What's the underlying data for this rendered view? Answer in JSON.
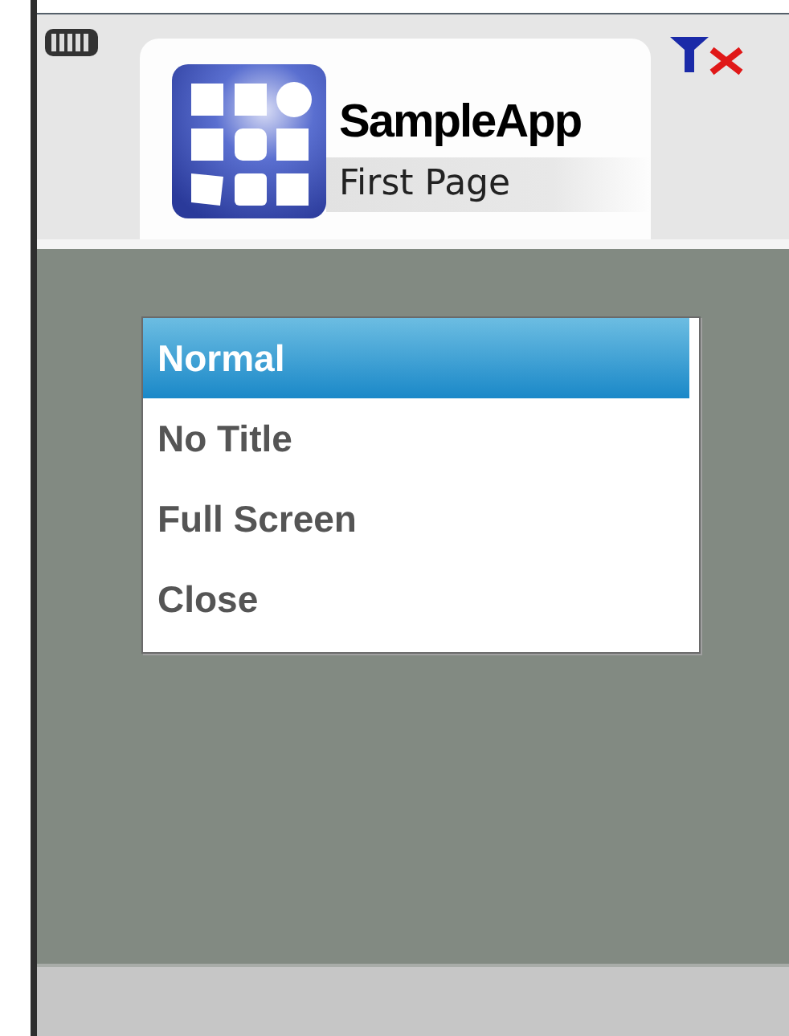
{
  "header": {
    "title": "SampleApp",
    "subtitle": "First Page"
  },
  "menu": [
    {
      "label": "Normal",
      "selected": true
    },
    {
      "label": "No Title",
      "selected": false
    },
    {
      "label": "Full Screen",
      "selected": false
    },
    {
      "label": "Close",
      "selected": false
    }
  ]
}
